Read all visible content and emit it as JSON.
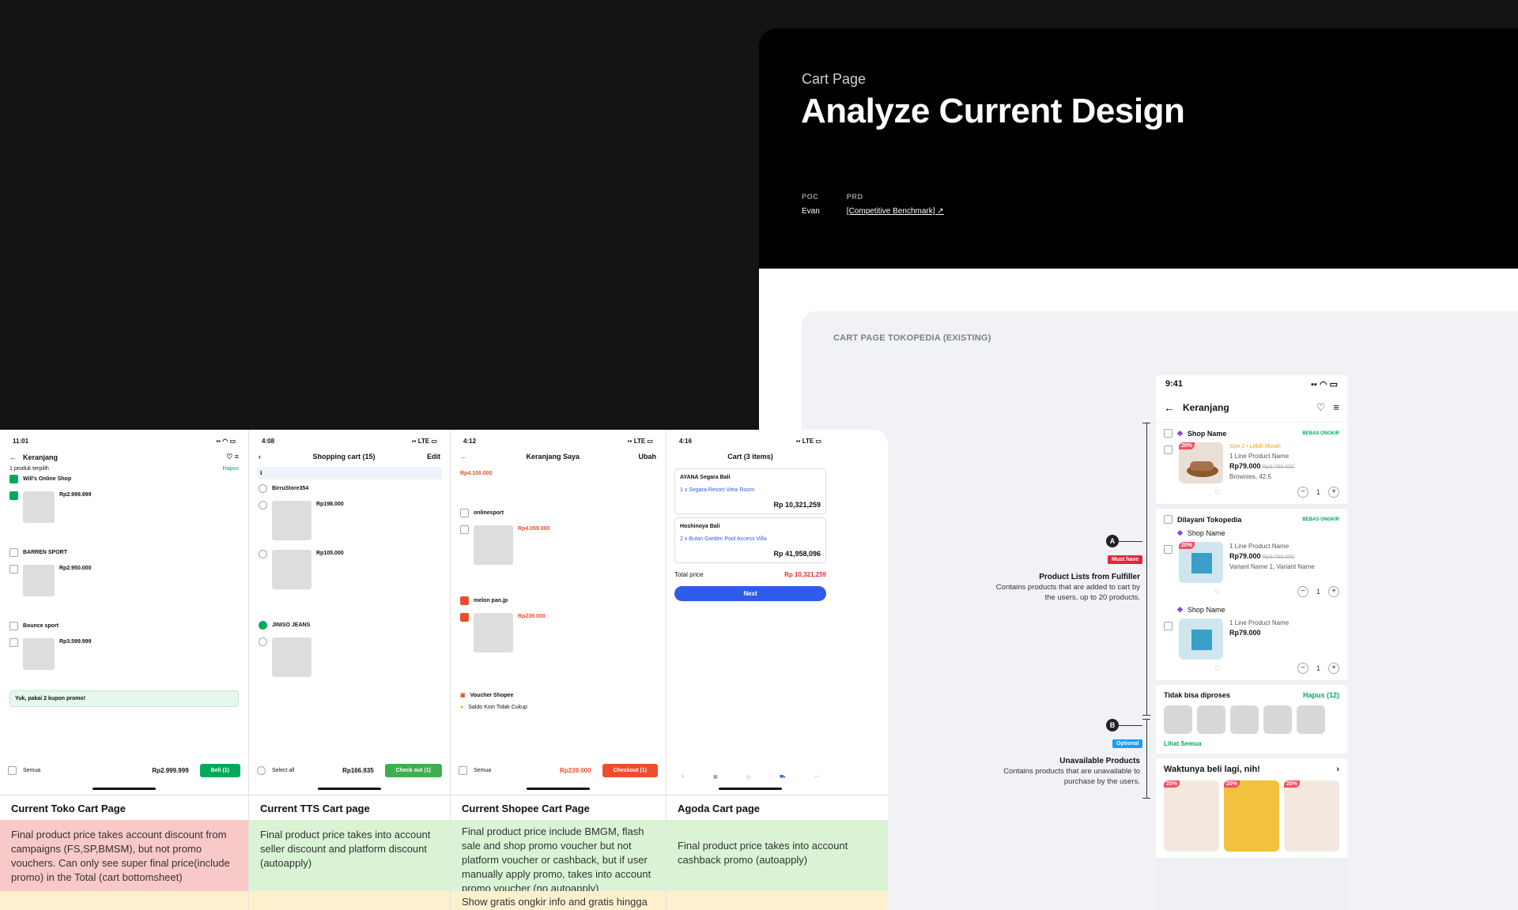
{
  "hero": {
    "eyebrow": "Cart Page",
    "title": "Analyze Current Design",
    "poc_label": "POC",
    "poc_value": "Evan",
    "prd_label": "PRD",
    "prd_value": "[Competitive Benchmark] ↗"
  },
  "panel": {
    "title": "CART PAGE TOKOPEDIA (EXISTING)",
    "annotation_a": {
      "pin": "A",
      "tag": "Must have",
      "title": "Product Lists from Fulfiller",
      "body": "Contains products that are added to cart by the users, up to 20 products."
    },
    "annotation_b": {
      "pin": "B",
      "tag": "Optional",
      "title": "Unavailable Products",
      "body": "Contains products that are unavailable to purchase by the users."
    }
  },
  "tokopedia_phone": {
    "time": "9:41",
    "status_icons": "▪▪ ◠ ▭",
    "header_title": "Keranjang",
    "shop_name": "Shop Name",
    "fulfiller": "Dilayani Tokopedia",
    "free_shipping_badge": "BEBAS ONGKIR",
    "discount": "20%",
    "variant_label": "Size 2 • Lebih Murah",
    "product_name": "1 Line Product Name",
    "price": "Rp79.000",
    "strike_price": "Rp3.765.000",
    "variant_1": "Brownies, 42.5",
    "variant_2": "Variant Name 1, Variant Name",
    "qty": "1",
    "unavailable_title": "Tidak bisa diproses",
    "unavailable_action": "Hapus (12)",
    "see_all": "Lihat Semua",
    "recs_title": "Waktunya beli lagi, nih!",
    "heart": "♡",
    "back": "←",
    "menu": "≡",
    "chevron": "›",
    "minus": "−",
    "plus": "+"
  },
  "comparisons": [
    {
      "caption": "Current Toko Cart Page",
      "time": "11:01",
      "title": "Keranjang",
      "subline": "1 produk terpilih",
      "action": "Hapus",
      "shops": [
        "Will's Online Shop",
        "BARREN SPORT",
        "Bounce sport"
      ],
      "prices": [
        "Rp2.999.999",
        "Rp2.950.000",
        "Rp3.599.999"
      ],
      "promo": "Yuk, pakai 2 kupon promo!",
      "select_all": "Semua",
      "total": "Rp2.999.999",
      "cta": "Beli (1)",
      "desc": "Final product price takes account discount from campaigns (FS,SP,BMSM), but not promo vouchers. Can only see super final price(include promo) in the Total (cart bottomsheet)",
      "desc_tone": "red"
    },
    {
      "caption": "Current TTS Cart page",
      "time": "4:08",
      "title": "Shopping cart (15)",
      "action": "Edit",
      "shops": [
        "BirruStore354",
        "JINISO JEANS"
      ],
      "prices": [
        "Rp198.000",
        "Rp105.000"
      ],
      "select_all": "Select all",
      "total": "Rp166.935",
      "cta": "Check out (1)",
      "desc": "Final product price takes into account seller discount and platform discount (autoapply)",
      "desc_tone": "green"
    },
    {
      "caption": "Current Shopee Cart Page",
      "time": "4:12",
      "title": "Keranjang Saya",
      "action": "Ubah",
      "shops": [
        "onlinesport",
        "melon pan.jp"
      ],
      "prices": [
        "Rp4.100.000",
        "Rp4.059.000",
        "Rp239.000"
      ],
      "voucher": "Voucher Shopee",
      "coins": "Saldo Koin Tidak Cukup",
      "select_all": "Semua",
      "total": "Rp239.000",
      "cta": "Checkout (1)",
      "desc": "Final product price include BMGM, flash sale and shop promo voucher but not platform voucher or cashback, but if user manually apply promo, takes into account promo voucher (no autoapply)",
      "desc2": "Show gratis ongkir info and gratis hingga",
      "desc_tone": "green"
    },
    {
      "caption": "Agoda Cart page",
      "time": "4:16",
      "title": "Cart (3 items)",
      "hotels": [
        "AYANA Segara Bali",
        "Hoshinoya Bali"
      ],
      "rooms": [
        "1 x Segara Resort View Room",
        "2 x Bulan Garden Pool Access Villa"
      ],
      "prices": [
        "Rp 10,321,259",
        "Rp 41,958,096"
      ],
      "total_label": "Total price",
      "total": "Rp 10,321,259",
      "cta": "Next",
      "desc": "Final product price takes into account cashback promo (autoapply)",
      "desc_tone": "green"
    }
  ]
}
